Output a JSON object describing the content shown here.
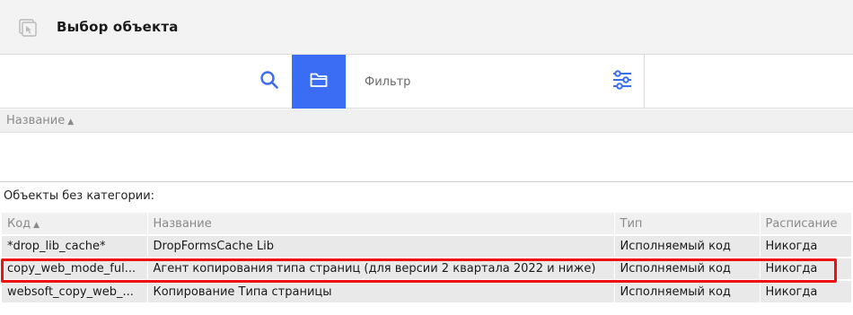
{
  "window": {
    "title": "Выбор объекта",
    "icon": "object-picker-icon"
  },
  "toolbar": {
    "search_icon": "search-icon",
    "folder_icon": "folder-icon",
    "filter_placeholder": "Фильтр",
    "settings_icon": "sliders-icon",
    "accent_color": "#3a6cf4"
  },
  "categories": {
    "header": "Название",
    "sort": "ascending"
  },
  "objects": {
    "section_label": "Объекты без категории:",
    "columns": {
      "code": "Код",
      "name": "Название",
      "type": "Тип",
      "schedule": "Расписание"
    },
    "rows": [
      {
        "code": "*drop_lib_cache*",
        "name": "DropFormsCache Lib",
        "type": "Исполняемый код",
        "schedule": "Никогда"
      },
      {
        "code": "copy_web_mode_ful...",
        "name": "Агент копирования типа страниц (для версии 2 квартала 2022 и ниже)",
        "type": "Исполняемый код",
        "schedule": "Никогда"
      },
      {
        "code": "websoft_copy_web_...",
        "name": "Копирование Типа страницы",
        "type": "Исполняемый код",
        "schedule": "Никогда"
      }
    ],
    "highlight_color": "#ee1111"
  }
}
